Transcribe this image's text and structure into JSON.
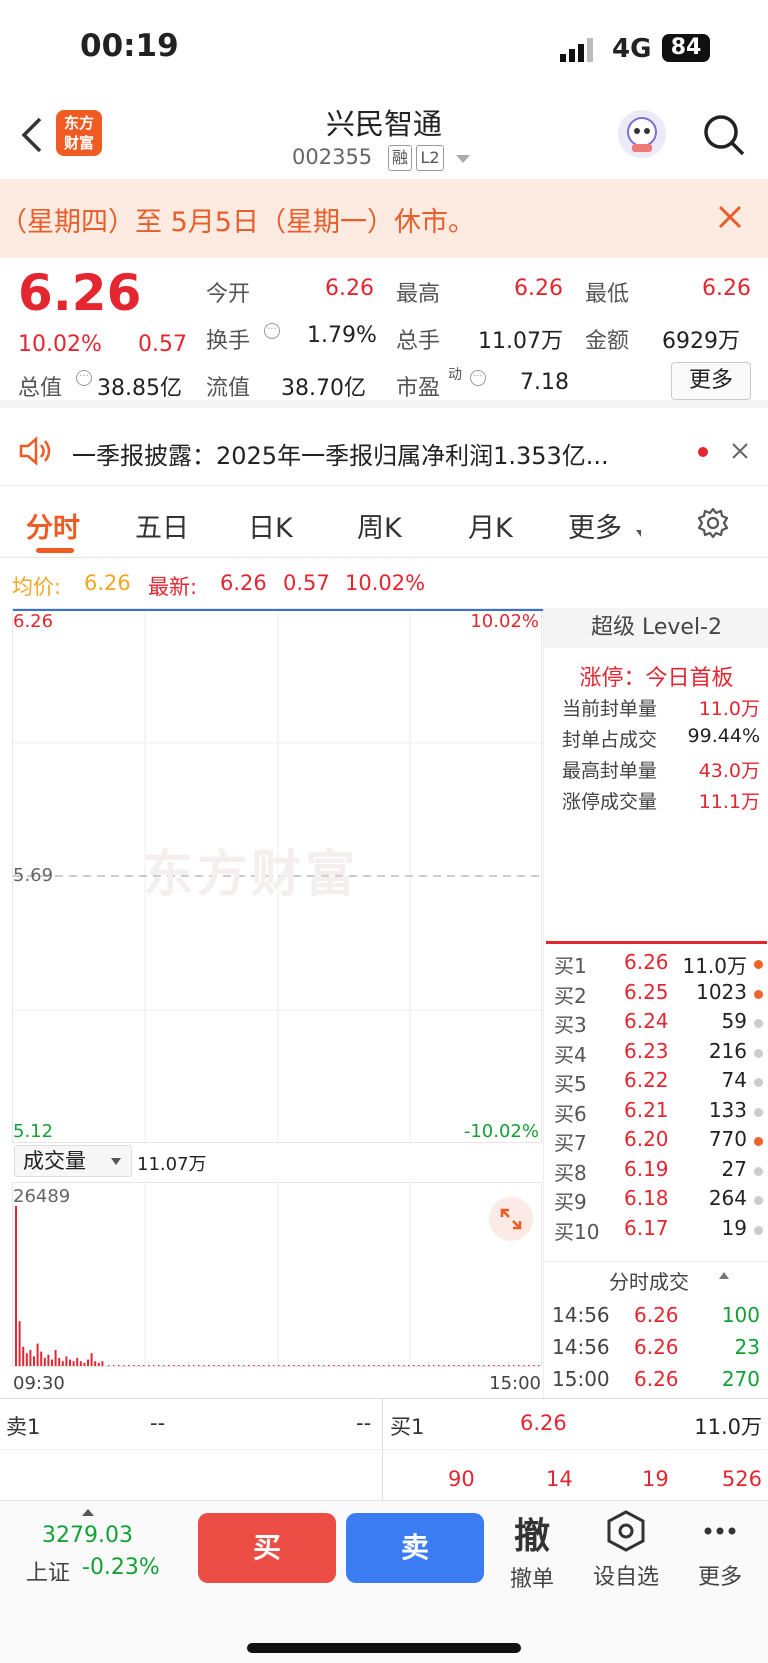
{
  "status": {
    "time": "00:19",
    "network": "4G",
    "battery": "84"
  },
  "header": {
    "name": "兴民智通",
    "code": "002355",
    "badge_rong": "融",
    "badge_l2": "L2",
    "logo_text": "东方\n财富"
  },
  "notice": {
    "text": "（星期四）至 5月5日（星期一）休市。"
  },
  "quote": {
    "price": "6.26",
    "change_pct": "10.02%",
    "change": "0.57",
    "open_label": "今开",
    "open": "6.26",
    "high_label": "最高",
    "high": "6.26",
    "low_label": "最低",
    "low": "6.26",
    "turnover_label": "换手",
    "turnover": "1.79%",
    "volume_label": "总手",
    "volume": "11.07万",
    "amount_label": "金额",
    "amount": "6929万",
    "mcap_label": "总值",
    "mcap": "38.85亿",
    "float_label": "流值",
    "float": "38.70亿",
    "pe_label": "市盈",
    "pe_sup": "动",
    "pe": "7.18",
    "more_button": "更多"
  },
  "news": {
    "text": "一季报披露：2025年一季报归属净利润1.353亿..."
  },
  "tabs": [
    "分时",
    "五日",
    "日K",
    "周K",
    "月K",
    "更多"
  ],
  "avg": {
    "avg_label": "均价:",
    "avg": "6.26",
    "latest_label": "最新:",
    "latest": "6.26",
    "change": "0.57",
    "pct": "10.02%"
  },
  "chart": {
    "y_top": "6.26",
    "y_mid": "5.69",
    "y_bot": "5.12",
    "pct_top": "10.02%",
    "pct_bot": "-10.02%",
    "watermark": "东方财富",
    "vol_select": "成交量",
    "vol_total": "11.07万",
    "vol_max": "26489",
    "time_start": "09:30",
    "time_end": "15:00"
  },
  "chart_data": {
    "type": "line",
    "x": [
      "09:30",
      "15:00"
    ],
    "series": [
      {
        "values": [
          6.26,
          6.26
        ]
      }
    ],
    "ylim": [
      5.12,
      6.26
    ],
    "volume_max": 26489
  },
  "level2": {
    "title": "超级 Level-2",
    "limit_up": "涨停：今日首板",
    "rows": [
      {
        "label": "当前封单量",
        "value": "11.0万"
      },
      {
        "label": "封单占成交",
        "value": "99.44%"
      },
      {
        "label": "最高封单量",
        "value": "43.0万"
      },
      {
        "label": "涨停成交量",
        "value": "11.1万"
      }
    ]
  },
  "orderbook": [
    {
      "label": "买1",
      "price": "6.26",
      "qty": "11.0万",
      "dot": "#f0642a"
    },
    {
      "label": "买2",
      "price": "6.25",
      "qty": "1023",
      "dot": "#f0642a"
    },
    {
      "label": "买3",
      "price": "6.24",
      "qty": "59",
      "dot": "#cccccc"
    },
    {
      "label": "买4",
      "price": "6.23",
      "qty": "216",
      "dot": "#cccccc"
    },
    {
      "label": "买5",
      "price": "6.22",
      "qty": "74",
      "dot": "#cccccc"
    },
    {
      "label": "买6",
      "price": "6.21",
      "qty": "133",
      "dot": "#cccccc"
    },
    {
      "label": "买7",
      "price": "6.20",
      "qty": "770",
      "dot": "#f0642a"
    },
    {
      "label": "买8",
      "price": "6.19",
      "qty": "27",
      "dot": "#cccccc"
    },
    {
      "label": "买9",
      "price": "6.18",
      "qty": "264",
      "dot": "#cccccc"
    },
    {
      "label": "买10",
      "price": "6.17",
      "qty": "19",
      "dot": "#cccccc"
    }
  ],
  "ticks": {
    "title": "分时成交",
    "rows": [
      {
        "time": "14:56",
        "price": "6.26",
        "qty": "100"
      },
      {
        "time": "14:56",
        "price": "6.26",
        "qty": "23"
      },
      {
        "time": "15:00",
        "price": "6.26",
        "qty": "270"
      }
    ]
  },
  "bottom": {
    "sell_label": "卖1",
    "sell_price": "--",
    "sell_qty": "--",
    "buy_label": "买1",
    "buy_price": "6.26",
    "buy_qty": "11.0万",
    "queue": [
      "90",
      "14",
      "19",
      "526"
    ]
  },
  "toolbar": {
    "index_value": "3279.03",
    "index_name": "上证",
    "index_pct": "-0.23%",
    "buy": "买",
    "sell": "卖",
    "cancel_icon": "撤",
    "cancel": "撤单",
    "watch": "设自选",
    "more": "更多"
  }
}
